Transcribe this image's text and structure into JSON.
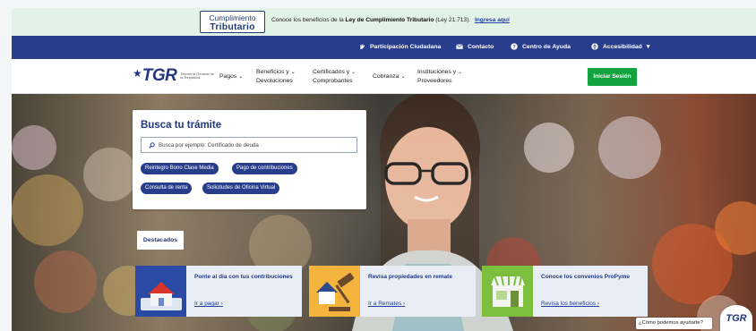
{
  "notice": {
    "logo_line1": "Cumplimiento",
    "logo_line2": "Tributario",
    "text_before": "Conoce los beneficios de la ",
    "text_bold": "Ley de Cumplimiento Tributario",
    "text_after": " (Ley 21.713).",
    "link": "Ingresa aquí"
  },
  "utility": {
    "items": [
      {
        "label": "Participación Ciudadana",
        "icon": "hand-icon"
      },
      {
        "label": "Contacto",
        "icon": "envelope-icon"
      },
      {
        "label": "Centro de Ayuda",
        "icon": "question-icon"
      },
      {
        "label": "Accesibilidad",
        "icon": "accessibility-icon"
      }
    ]
  },
  "nav": {
    "brand": "TGR",
    "brand_sub": "Tesorería General de la República",
    "items": [
      {
        "line1": "Pagos",
        "line2": ""
      },
      {
        "line1": "Beneficios y",
        "line2": "Devoluciones"
      },
      {
        "line1": "Certificados y",
        "line2": "Comprobantes"
      },
      {
        "line1": "Cobranza",
        "line2": ""
      },
      {
        "line1": "Instituciones y",
        "line2": "Proveedores"
      }
    ],
    "login": "Iniciar Sesión"
  },
  "search": {
    "title": "Busca tu trámite",
    "placeholder": "Busca por ejemplo: Certificado de deuda",
    "chips": [
      "Reintegro Bono Clase Media",
      "Pago de contribuciones",
      "Consulta de renta",
      "Solicitudes de Oficina Virtual"
    ]
  },
  "destacados": "Destacados",
  "cards": [
    {
      "title": "Ponte al día con tus contribuciones",
      "link": "Ir a pagar"
    },
    {
      "title": "Revisa propiedades en remate",
      "link": "Ir a Remates"
    },
    {
      "title": "Conoce los convenios ProPyme",
      "link": "Revisa los beneficios"
    }
  ],
  "help": {
    "label": "¿Cómo podemos ayudarte?",
    "bot": "TGR"
  },
  "colors": {
    "primary": "#283d8c",
    "accent_green": "#13a33f",
    "notice_bg": "#e3f2e6"
  }
}
